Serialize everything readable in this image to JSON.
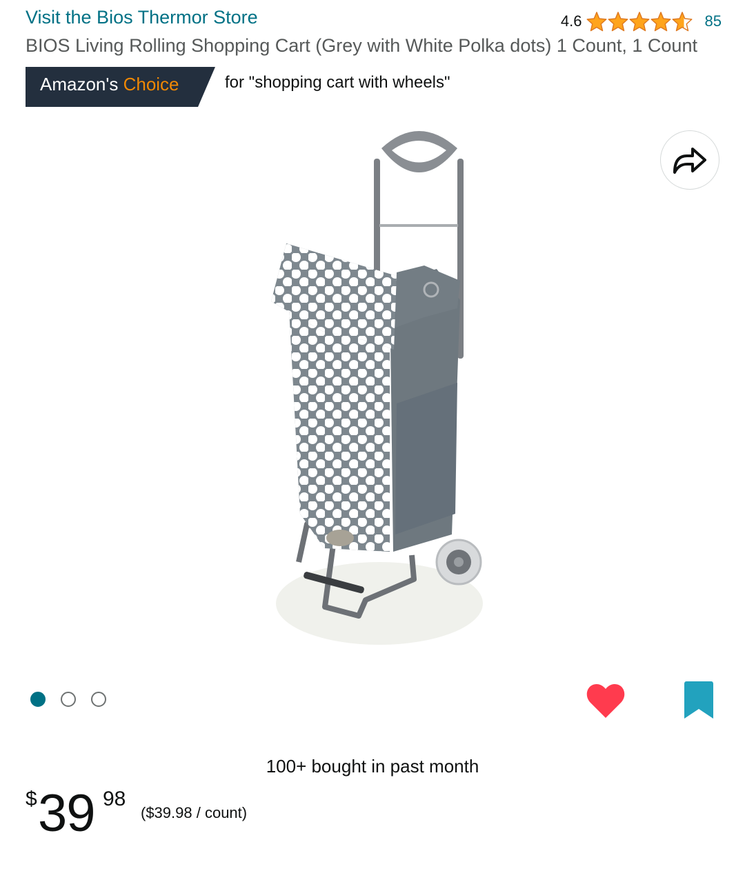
{
  "store_link": "Visit the Bios Thermor Store",
  "rating": {
    "value": "4.6",
    "stars": 4.6,
    "count": "85"
  },
  "product": {
    "title": "BIOS Living Rolling Shopping Cart (Grey with White Polka dots) 1 Count, 1 Count"
  },
  "badge": {
    "prefix": "Amazon's",
    "highlight": "Choice",
    "query": "for \"shopping cart with wheels\""
  },
  "icons": {
    "share": "share-icon",
    "heart": "heart-icon",
    "bookmark": "bookmark-icon",
    "star": "star-icon"
  },
  "gallery": {
    "image_count": 3,
    "active_index": 0
  },
  "social_proof": "100+ bought in past month",
  "price": {
    "symbol": "$",
    "whole": "39",
    "fraction": "98",
    "unit_price": "($39.98 / count)"
  },
  "colors": {
    "link": "#007185",
    "star": "#ffa41c",
    "badge_bg": "#232f3e",
    "badge_accent": "#f08804",
    "heart": "#ff3b4e",
    "bookmark": "#22a2be"
  }
}
